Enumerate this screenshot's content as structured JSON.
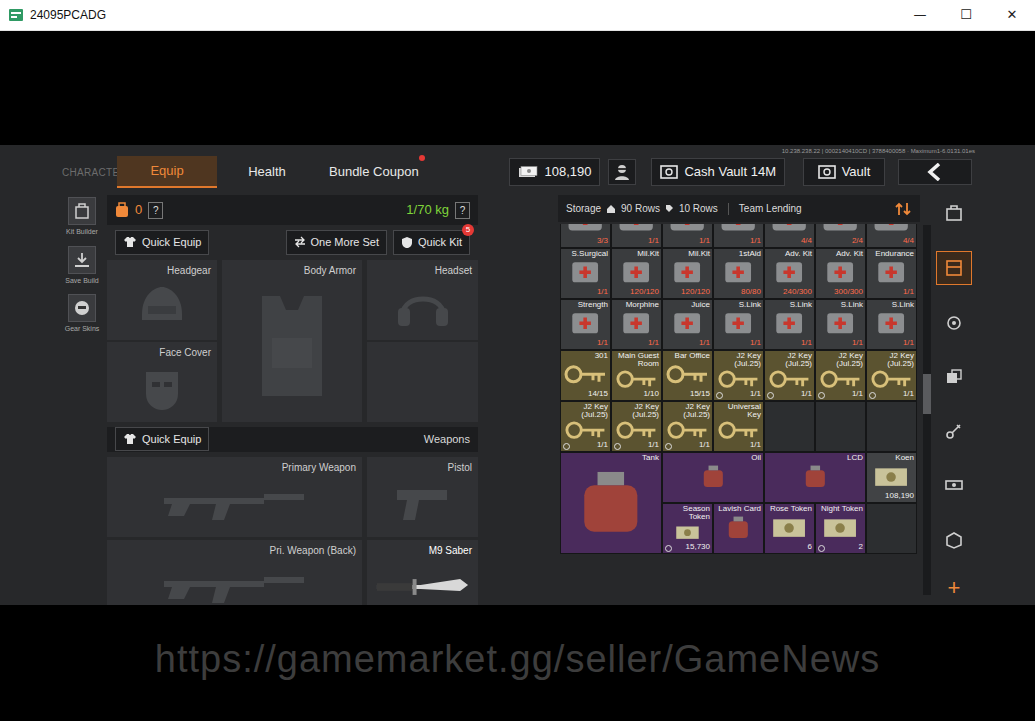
{
  "window": {
    "title": "24095PCADG",
    "controls": [
      "—",
      "☐",
      "✕"
    ]
  },
  "game": {
    "server_info": "10.238.238.22 | 0002140410CD | 3788400058 · Maximum1-6.0131.01es",
    "section": "CHARACTER",
    "tabs": [
      {
        "label": "Equip",
        "selected": true,
        "dot": false
      },
      {
        "label": "Health",
        "selected": false,
        "dot": false
      },
      {
        "label": "Bundle Coupon",
        "selected": false,
        "dot": true
      }
    ],
    "money": "108,190",
    "cash_vault": "Cash Vault 14M",
    "vault": "Vault"
  },
  "sidebar": [
    {
      "label": "Kit Builder"
    },
    {
      "label": "Save Build"
    },
    {
      "label": "Gear Skins"
    }
  ],
  "equip": {
    "backpack_count": "0",
    "help": "?",
    "weight": "1/70 kg",
    "weight_help": "?",
    "buttons": [
      {
        "label": "Quick Equip"
      },
      {
        "label": "One More Set"
      },
      {
        "label": "Quick Kit",
        "badge": "5"
      }
    ],
    "gear_slots": [
      {
        "label": "Headgear",
        "kind": "helmet",
        "equipped": false
      },
      {
        "label": "Body Armor",
        "kind": "armor",
        "equipped": false
      },
      {
        "label": "Headset",
        "kind": "headset",
        "equipped": false
      },
      {
        "label": "Face Cover",
        "kind": "mask",
        "equipped": false
      },
      {
        "kind": "empty",
        "equipped": false
      }
    ],
    "weapons_button": "Quick Equip",
    "weapons_label": "Weapons",
    "weapon_slots": [
      {
        "label": "Primary Weapon",
        "kind": "rifle",
        "equipped": false
      },
      {
        "label": "Pistol",
        "kind": "pistol",
        "equipped": false
      },
      {
        "label": "Pri. Weapon (Back)",
        "kind": "rifle",
        "equipped": false
      },
      {
        "label": "M9 Saber",
        "kind": "knife",
        "equipped": true
      }
    ]
  },
  "storage": {
    "label": "Storage",
    "rows_total": "90 Rows",
    "rows_shown": "10 Rows",
    "team_lending": "Team Lending",
    "scroll_level": 0.45,
    "items": [
      {
        "count": "3/3",
        "kind": "consumable",
        "color": "#3a3c3e",
        "w": 1,
        "h": 1,
        "timed": false
      },
      {
        "count": "1/1",
        "kind": "consumable",
        "color": "#3a3c3e",
        "w": 1,
        "h": 1,
        "timed": false
      },
      {
        "count": "1/1",
        "kind": "consumable",
        "color": "#3a3c3e",
        "w": 1,
        "h": 1,
        "timed": false
      },
      {
        "count": "1/1",
        "kind": "consumable",
        "color": "#3a3c3e",
        "w": 1,
        "h": 1,
        "timed": false
      },
      {
        "count": "4/4",
        "kind": "consumable",
        "color": "#3a3c3e",
        "w": 1,
        "h": 1,
        "timed": false
      },
      {
        "count": "2/4",
        "kind": "consumable",
        "color": "#3a3c3e",
        "w": 1,
        "h": 1,
        "timed": false
      },
      {
        "count": "4/4",
        "kind": "consumable",
        "color": "#3a3c3e",
        "w": 1,
        "h": 1,
        "timed": false
      },
      {
        "name": "S.Surgical",
        "count": "1/1",
        "kind": "consumable",
        "color": "#3a3c3e",
        "w": 1,
        "h": 1,
        "timed": false
      },
      {
        "name": "Mil.Kit",
        "count": "120/120",
        "kind": "consumable",
        "color": "#3a3c3e",
        "w": 1,
        "h": 1,
        "timed": false
      },
      {
        "name": "Mil.Kit",
        "count": "120/120",
        "kind": "consumable",
        "color": "#3a3c3e",
        "w": 1,
        "h": 1,
        "timed": false
      },
      {
        "name": "1stAid",
        "count": "80/80",
        "kind": "consumable",
        "color": "#3a3c3e",
        "w": 1,
        "h": 1,
        "timed": false
      },
      {
        "name": "Adv. Kit",
        "count": "240/300",
        "kind": "consumable",
        "color": "#3a3c3e",
        "w": 1,
        "h": 1,
        "timed": false
      },
      {
        "name": "Adv. Kit",
        "count": "300/300",
        "kind": "consumable",
        "color": "#3a3c3e",
        "w": 1,
        "h": 1,
        "timed": false
      },
      {
        "name": "Endurance",
        "count": "1/1",
        "kind": "consumable",
        "color": "#3a3c3e",
        "w": 1,
        "h": 1,
        "timed": false
      },
      {
        "name": "Strength",
        "count": "1/1",
        "kind": "consumable",
        "color": "#3a3c3e",
        "w": 1,
        "h": 1,
        "timed": false
      },
      {
        "name": "Morphine",
        "count": "1/1",
        "kind": "consumable",
        "color": "#3a3c3e",
        "w": 1,
        "h": 1,
        "timed": false
      },
      {
        "name": "Juice",
        "count": "1/1",
        "kind": "consumable",
        "color": "#3a3c3e",
        "w": 1,
        "h": 1,
        "timed": false
      },
      {
        "name": "S.Link",
        "count": "1/1",
        "kind": "consumable",
        "color": "#3a3c3e",
        "w": 1,
        "h": 1,
        "timed": false
      },
      {
        "name": "S.Link",
        "count": "1/1",
        "kind": "consumable",
        "color": "#3a3c3e",
        "w": 1,
        "h": 1,
        "timed": false
      },
      {
        "name": "S.Link",
        "count": "1/1",
        "kind": "consumable",
        "color": "#3a3c3e",
        "w": 1,
        "h": 1,
        "timed": false
      },
      {
        "name": "S.Link",
        "count": "1/1",
        "kind": "consumable",
        "color": "#3a3c3e",
        "w": 1,
        "h": 1,
        "timed": false
      },
      {
        "name": "301",
        "count": "14/15",
        "kind": "key",
        "color": "#5b5330",
        "w": 1,
        "h": 1,
        "timed": false
      },
      {
        "name": "Main Guest Room",
        "count": "1/10",
        "kind": "key",
        "color": "#5b5330",
        "w": 1,
        "h": 1,
        "timed": false
      },
      {
        "name": "Bar Office",
        "count": "15/15",
        "kind": "key",
        "color": "#5b5330",
        "w": 1,
        "h": 1,
        "timed": false
      },
      {
        "name": "J2 Key (Jul.25)",
        "count": "1/1",
        "kind": "key",
        "color": "#5b5330",
        "w": 1,
        "h": 1,
        "timed": true
      },
      {
        "name": "J2 Key (Jul.25)",
        "count": "1/1",
        "kind": "key",
        "color": "#5b5330",
        "w": 1,
        "h": 1,
        "timed": true
      },
      {
        "name": "J2 Key (Jul.25)",
        "count": "1/1",
        "kind": "key",
        "color": "#5b5330",
        "w": 1,
        "h": 1,
        "timed": true
      },
      {
        "name": "J2 Key (Jul.25)",
        "count": "1/1",
        "kind": "key",
        "color": "#5b5330",
        "w": 1,
        "h": 1,
        "timed": true
      },
      {
        "name": "J2 Key (Jul.25)",
        "count": "1/1",
        "kind": "key",
        "color": "#5b5330",
        "w": 1,
        "h": 1,
        "timed": true
      },
      {
        "name": "J2 Key (Jul.25)",
        "count": "1/1",
        "kind": "key",
        "color": "#5b5330",
        "w": 1,
        "h": 1,
        "timed": true
      },
      {
        "name": "J2 Key (Jul.25)",
        "count": "1/1",
        "kind": "key",
        "color": "#5b5330",
        "w": 1,
        "h": 1,
        "timed": true
      },
      {
        "name": "Universal Key",
        "count": "1/1",
        "kind": "key",
        "color": "#5b5330",
        "w": 1,
        "h": 1,
        "timed": false
      },
      {
        "kind": "empty",
        "color": "#2c2e30",
        "w": 1,
        "h": 1,
        "timed": false
      },
      {
        "kind": "empty",
        "color": "#2c2e30",
        "w": 1,
        "h": 1,
        "timed": false
      },
      {
        "kind": "empty",
        "color": "#2c2e30",
        "w": 1,
        "h": 1,
        "timed": false
      },
      {
        "name": "Tank",
        "kind": "valuable",
        "color": "#4a2b5c",
        "w": 2,
        "h": 2,
        "timed": false
      },
      {
        "name": "Oil",
        "kind": "valuable",
        "color": "#4a2b5c",
        "w": 2,
        "h": 1,
        "timed": false
      },
      {
        "name": "LCD",
        "kind": "valuable",
        "color": "#4a2b5c",
        "w": 2,
        "h": 1,
        "timed": false
      },
      {
        "name": "Koen",
        "count": "108,190",
        "kind": "currency",
        "color": "#414345",
        "w": 1,
        "h": 1,
        "timed": false
      },
      {
        "name": "Season Token",
        "count": "15,730",
        "kind": "currency",
        "color": "#4a2b5c",
        "w": 1,
        "h": 1,
        "timed": true
      },
      {
        "name": "Lavish Card",
        "kind": "valuable",
        "color": "#4a2b5c",
        "w": 1,
        "h": 1,
        "timed": false
      },
      {
        "name": "Rose Token",
        "count": "6",
        "kind": "currency",
        "color": "#4a2b5c",
        "w": 1,
        "h": 1,
        "timed": false
      },
      {
        "name": "Night Token",
        "count": "2",
        "kind": "currency",
        "color": "#4a2b5c",
        "w": 1,
        "h": 1,
        "timed": true
      },
      {
        "kind": "empty",
        "color": "#2c2e30",
        "w": 1,
        "h": 1,
        "timed": false
      }
    ]
  },
  "side_tabs": {
    "items": [
      {
        "selected": false
      },
      {
        "selected": true
      },
      {
        "selected": false
      },
      {
        "selected": false
      },
      {
        "selected": false
      },
      {
        "selected": false
      },
      {
        "selected": false
      }
    ],
    "add": "+"
  },
  "watermark": "https://gamemarket.gg/seller/GameNews"
}
